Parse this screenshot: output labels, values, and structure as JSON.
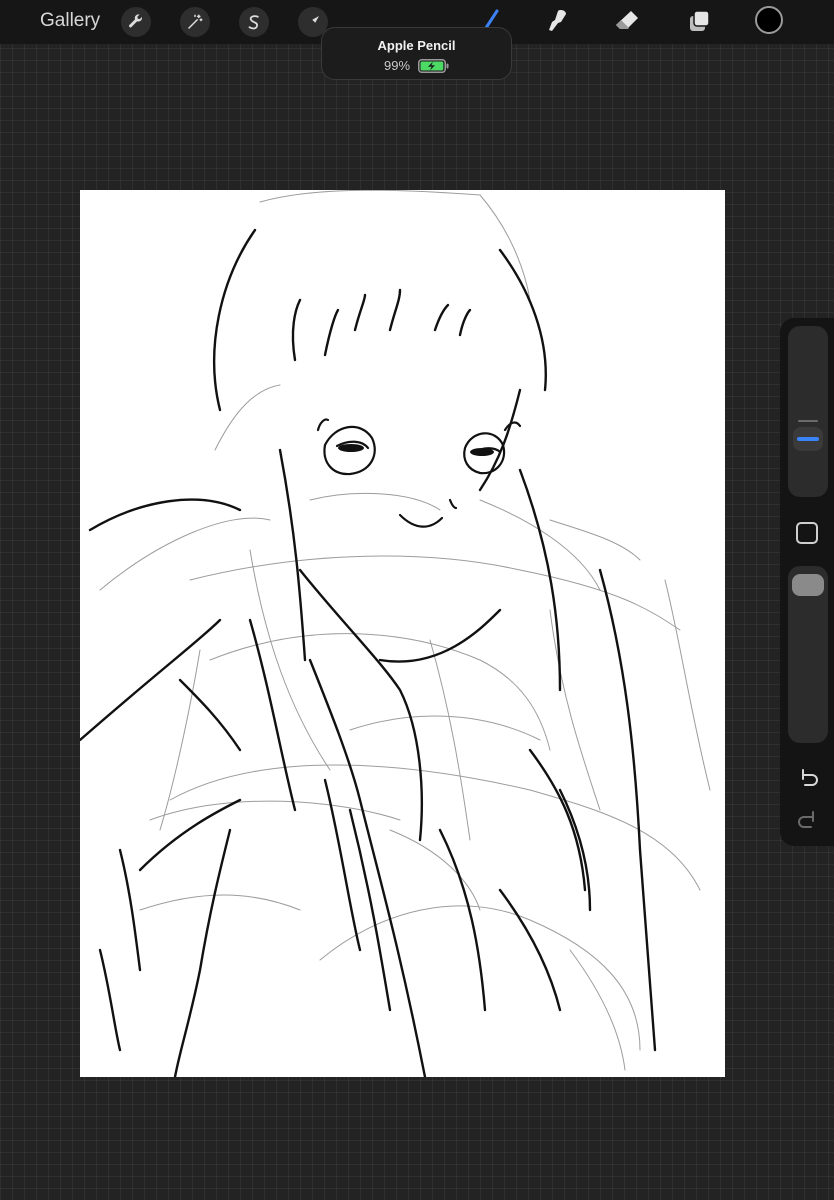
{
  "topbar": {
    "gallery_label": "Gallery",
    "left_tools": [
      "wrench-icon",
      "magic-wand-icon",
      "selection-icon",
      "transform-arrow-icon"
    ],
    "right_tools": [
      "brush-icon",
      "smudge-icon",
      "eraser-icon",
      "layers-icon"
    ],
    "active_tool": "brush-icon",
    "active_color": "#000000",
    "accent_color": "#3b82f6"
  },
  "toast": {
    "title": "Apple Pencil",
    "battery_percent": "99%",
    "battery_level": 0.99,
    "battery_color": "#4cd964"
  },
  "sidebar": {
    "brush_size_level": 0.3,
    "brush_opacity_level": 0.0,
    "icons": [
      "modify-square-icon",
      "undo-icon",
      "redo-icon"
    ]
  },
  "canvas": {
    "background": "#ffffff",
    "content": "sketch-drawing"
  }
}
